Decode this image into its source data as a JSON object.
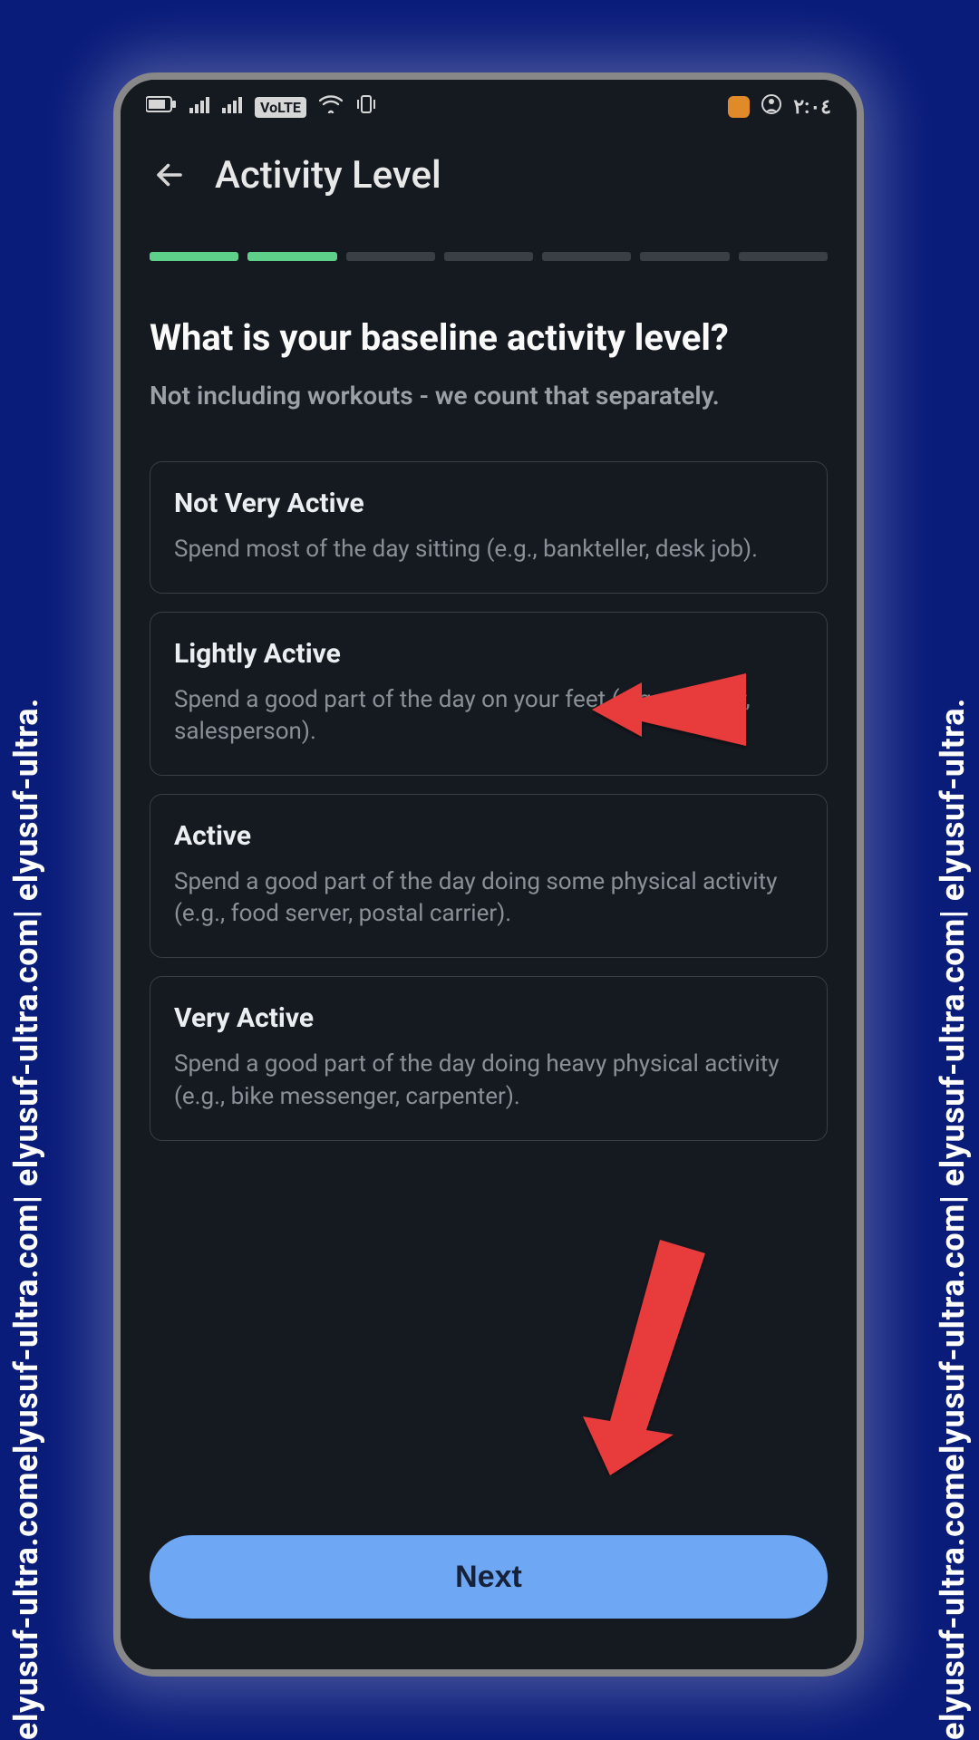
{
  "watermark_text": "elyusuf-ultra.comelyusuf-ultra.com| elyusuf-ultra.com| elyusuf-ultra.",
  "status": {
    "time": "٢:٠٤",
    "volte": "VoLTE"
  },
  "header": {
    "title": "Activity Level"
  },
  "progress": {
    "completed": 2,
    "total": 7
  },
  "question": {
    "title": "What is your baseline activity level?",
    "subtitle": "Not including workouts - we count that separately."
  },
  "options": [
    {
      "title": "Not Very Active",
      "description": "Spend most of the day sitting (e.g., bankteller, desk job)."
    },
    {
      "title": "Lightly Active",
      "description": "Spend a good part of the day on your feet (e.g., teacher, salesperson)."
    },
    {
      "title": "Active",
      "description": "Spend a good part of the day doing some physical activity (e.g., food server, postal carrier)."
    },
    {
      "title": "Very Active",
      "description": "Spend a good part of the day doing heavy physical activity (e.g., bike messenger, carpenter)."
    }
  ],
  "cta": {
    "next_label": "Next"
  }
}
